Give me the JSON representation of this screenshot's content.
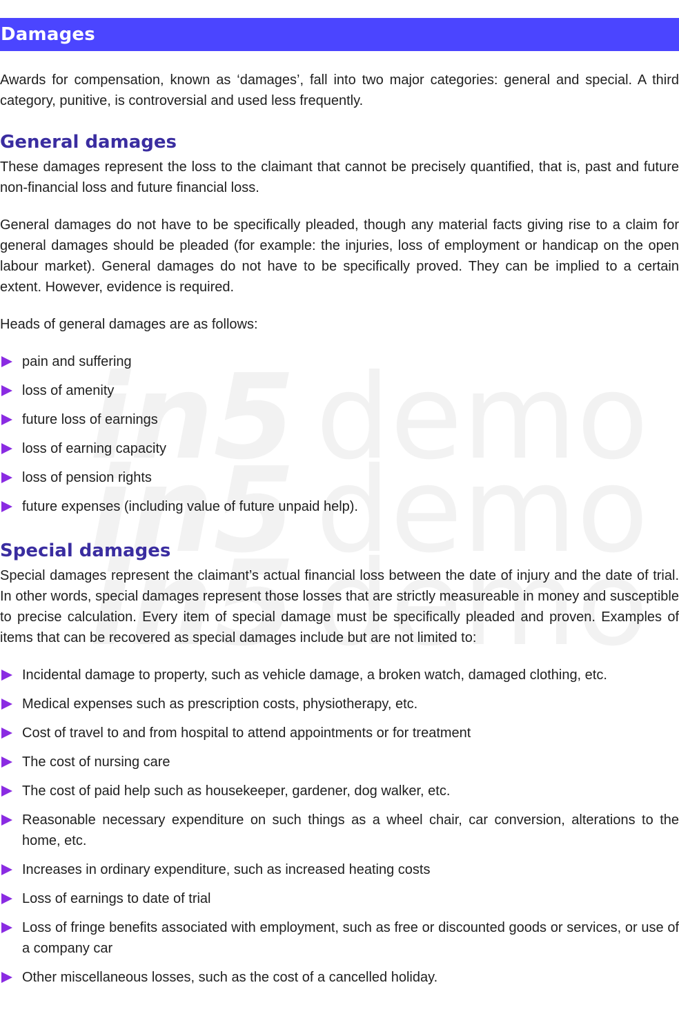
{
  "header": {
    "title": "Damages"
  },
  "intro": "Awards for compensation, known as ‘damages’, fall into two major categories: general and special. A third category, punitive, is controversial and used less frequently.",
  "general": {
    "heading": "General damages",
    "paragraphs": [
      "These damages represent the loss to the claimant that cannot be precisely quantified, that is, past and future non-financial loss and future financial loss.",
      "General damages do not have to be specifically pleaded, though any material facts giving rise to a claim for general damages should be pleaded (for example: the injuries, loss of employment or handicap on the open labour market). General damages do not have to be specifically proved. They can be implied to a certain extent. However, evidence is required.",
      "Heads of general damages are as follows:"
    ],
    "items": [
      "pain and suffering",
      "loss of amenity",
      "future loss of earnings",
      "loss of earning capacity",
      "loss of pension rights",
      "future expenses (including value of future unpaid help)."
    ]
  },
  "special": {
    "heading": "Special damages",
    "paragraph": "Special damages represent the claimant’s actual financial loss between the date of injury and the date of trial. In other words, special damages represent those losses that are strictly measureable in money and susceptible to precise calculation. Every item of special damage must be specifically pleaded and proven. Examples of items that can be recovered as special damages include but are not limited to:",
    "items": [
      "Incidental damage to property, such as vehicle damage, a broken watch, damaged clothing, etc.",
      "Medical expenses such as prescription costs, physiotherapy, etc.",
      "Cost of travel to and from hospital to attend appointments or for treatment",
      "The cost of nursing care",
      "The cost of paid help such as housekeeper, gardener, dog walker, etc.",
      "Reasonable necessary expenditure on such things as a wheel chair, car conversion, alterations to the home, etc.",
      "Increases in ordinary expenditure, such as increased heating costs",
      "Loss of earnings to date of trial",
      "Loss of fringe benefits associated with employment, such as free or discounted goods or services, or use of a company car",
      "Other miscellaneous losses, such as the cost of a cancelled holiday."
    ]
  },
  "watermark": {
    "brand": "in5",
    "word": "demo"
  },
  "colors": {
    "banner": "#4b45ff",
    "heading": "#3a2da0",
    "bullet": "#8a2be2"
  }
}
